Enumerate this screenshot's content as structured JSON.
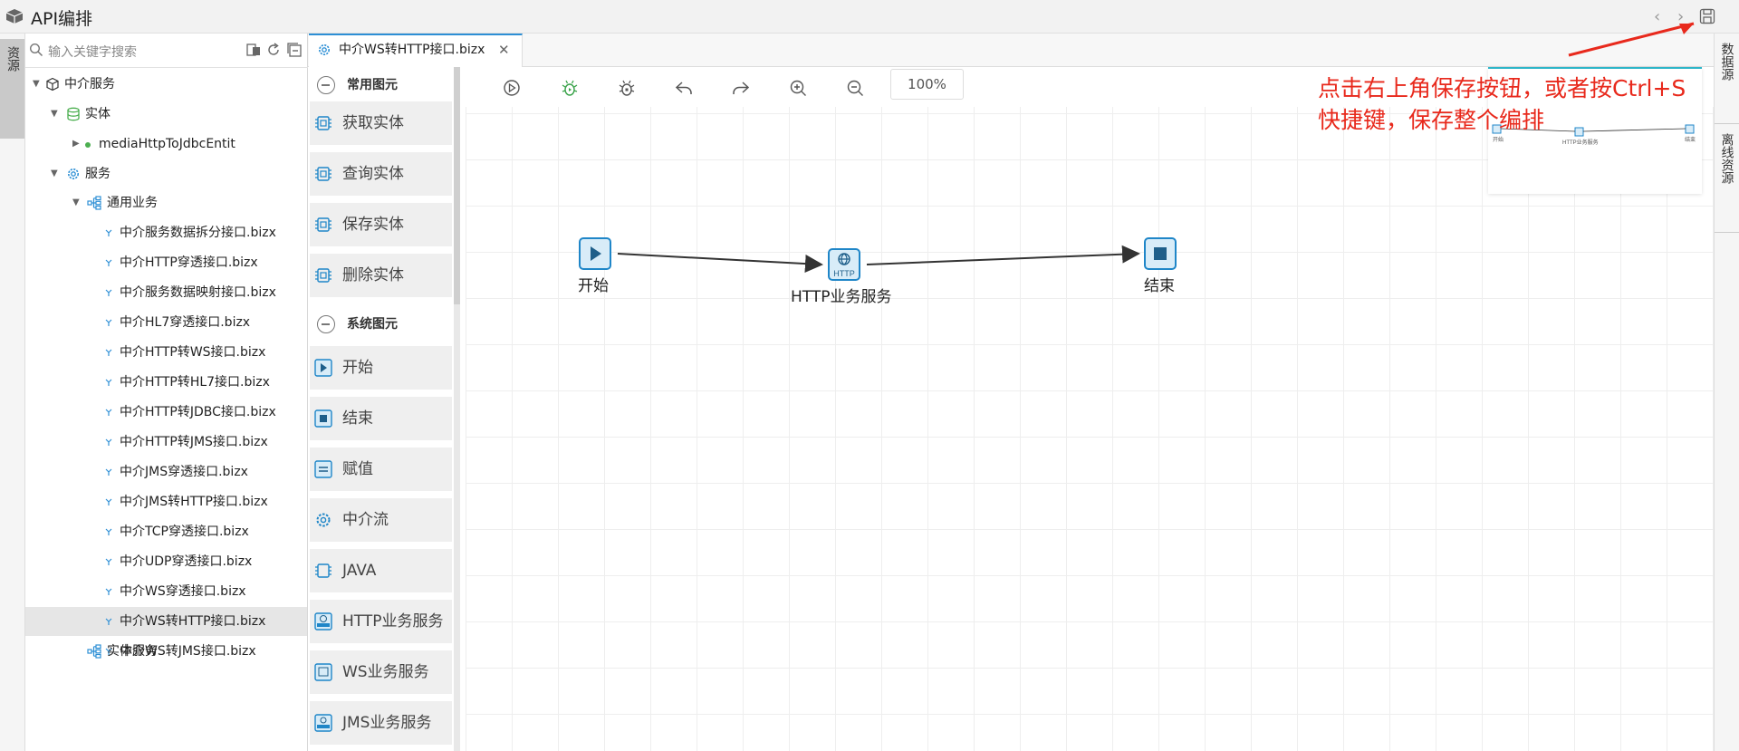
{
  "app": {
    "title": "API编排"
  },
  "left_rail": {
    "tab": "资源"
  },
  "right_rail": {
    "tabs": [
      "数据源",
      "离线资源"
    ]
  },
  "search": {
    "placeholder": "输入关键字搜索"
  },
  "tree": {
    "root": "中介服务",
    "entity_group": "实体",
    "entity_item": "mediaHttpToJdbcEntit",
    "service_group": "服务",
    "business_group": "通用业务",
    "files": [
      "中介服务数据拆分接口.bizx",
      "中介HTTP穿透接口.bizx",
      "中介服务数据映射接口.bizx",
      "中介HL7穿透接口.bizx",
      "中介HTTP转WS接口.bizx",
      "中介HTTP转HL7接口.bizx",
      "中介HTTP转JDBC接口.bizx",
      "中介HTTP转JMS接口.bizx",
      "中介JMS穿透接口.bizx",
      "中介JMS转HTTP接口.bizx",
      "中介TCP穿透接口.bizx",
      "中介UDP穿透接口.bizx",
      "中介WS穿透接口.bizx",
      "中介WS转HTTP接口.bizx",
      "中介WS转JMS接口.bizx"
    ],
    "selected_index": 13,
    "entity_service": "实体服务"
  },
  "editor_tab": {
    "label": "中介WS转HTTP接口.bizx",
    "close": "✕"
  },
  "palette": {
    "common_header": "常用图元",
    "common_items": [
      "获取实体",
      "查询实体",
      "保存实体",
      "删除实体"
    ],
    "system_header": "系统图元",
    "system_items": [
      "开始",
      "结束",
      "赋值",
      "中介流",
      "JAVA",
      "HTTP业务服务",
      "WS业务服务",
      "JMS业务服务"
    ]
  },
  "toolbar": {
    "zoom": "100%"
  },
  "flow": {
    "start_label": "开始",
    "http_label": "HTTP业务服务",
    "http_icon_text": "HTTP",
    "end_label": "结束"
  },
  "minimap": {
    "start": "开始",
    "http": "HTTP业务服务",
    "end": "结束"
  },
  "annotation": {
    "line1": "点击右上角保存按钮，或者按Ctrl+S",
    "line2": "快捷键，保存整个编排"
  },
  "colors": {
    "accent": "#2d8fd5",
    "annotation": "#e8291c",
    "node_fill": "#d8ecf8",
    "node_stroke": "#1f86c8"
  }
}
